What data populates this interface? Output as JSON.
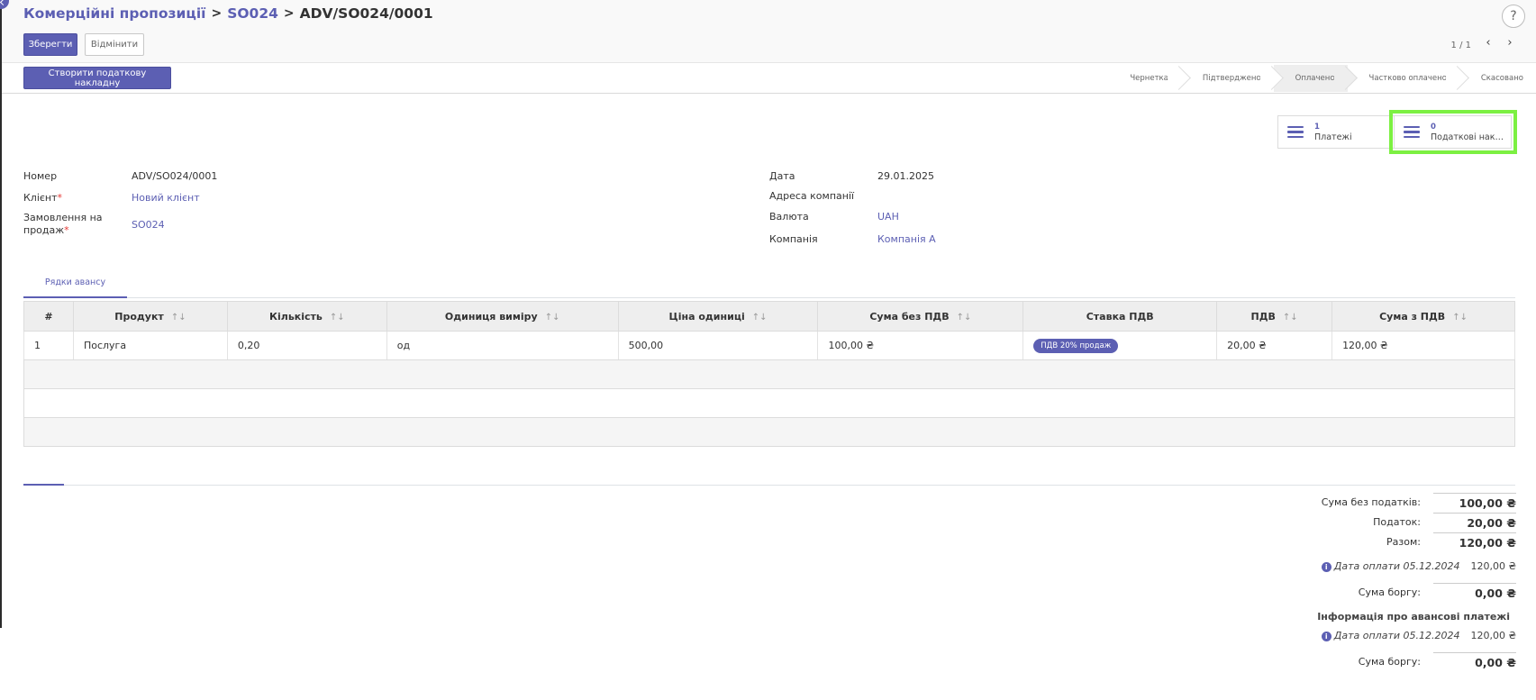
{
  "breadcrumb": {
    "root": "Комерційні пропозиції",
    "sep": ">",
    "parent": "SO024",
    "current": "ADV/SO024/0001"
  },
  "actions": {
    "save": "Зберегти",
    "discard": "Відмінити",
    "create_tax_invoice": "Створити податкову накладну"
  },
  "help": "?",
  "pager": {
    "text": "1 / 1",
    "prev": "‹",
    "next": "›"
  },
  "stages": [
    {
      "label": "Чернетка",
      "active": false
    },
    {
      "label": "Підтверджено",
      "active": false
    },
    {
      "label": "Оплачено",
      "active": true
    },
    {
      "label": "Частково оплачено",
      "active": false
    },
    {
      "label": "Скасовано",
      "active": false
    }
  ],
  "smart_buttons": [
    {
      "count": "1",
      "label": "Платежі",
      "icon": "list-icon"
    },
    {
      "count": "0",
      "label": "Податкові накла...",
      "icon": "list-icon"
    }
  ],
  "fields_left": {
    "number_label": "Номер",
    "number_value": "ADV/SO024/0001",
    "client_label": "Клієнт",
    "client_value": "Новий клієнт",
    "order_label_1": "Замовлення на",
    "order_label_2": "продаж",
    "order_value": "SO024",
    "required_mark": "*"
  },
  "fields_right": {
    "date_label": "Дата",
    "date_value": "29.01.2025",
    "address_label": "Адреса компанії",
    "address_value": "",
    "currency_label": "Валюта",
    "currency_value": "UAH",
    "company_label": "Компанія",
    "company_value": "Компанія А"
  },
  "tab": {
    "label": "Рядки авансу"
  },
  "table": {
    "headers": [
      "#",
      "Продукт",
      "Кількість",
      "Одиниця виміру",
      "Ціна одиниці",
      "Сума без ПДВ",
      "Ставка ПДВ",
      "ПДВ",
      "Сума з ПДВ"
    ],
    "sort_icon": "↑↓",
    "rows": [
      {
        "n": "1",
        "product": "Послуга",
        "qty": "0,20",
        "uom": "од",
        "price": "500,00",
        "subtotal": "100,00 ₴",
        "tax": "ПДВ 20% продаж",
        "vat": "20,00 ₴",
        "total": "120,00 ₴"
      }
    ]
  },
  "totals": {
    "untaxed_label": "Сума без податків:",
    "untaxed_value": "100,00 ₴",
    "tax_label": "Податок:",
    "tax_value": "20,00 ₴",
    "total_label": "Разом:",
    "total_value": "120,00 ₴",
    "payment_date": "Дата оплати 05.12.2024",
    "payment_amount": "120,00 ₴",
    "due_label": "Сума боргу:",
    "due_value": "0,00 ₴",
    "advance_title": "Інформація про авансові платежі",
    "adv_payment_date": "Дата оплати 05.12.2024",
    "adv_payment_amount": "120,00 ₴",
    "adv_due_label": "Сума боргу:",
    "adv_due_value": "0,00 ₴",
    "info_icon": "i"
  },
  "colors": {
    "accent": "#5c5fb3",
    "highlight": "#7cf042"
  }
}
